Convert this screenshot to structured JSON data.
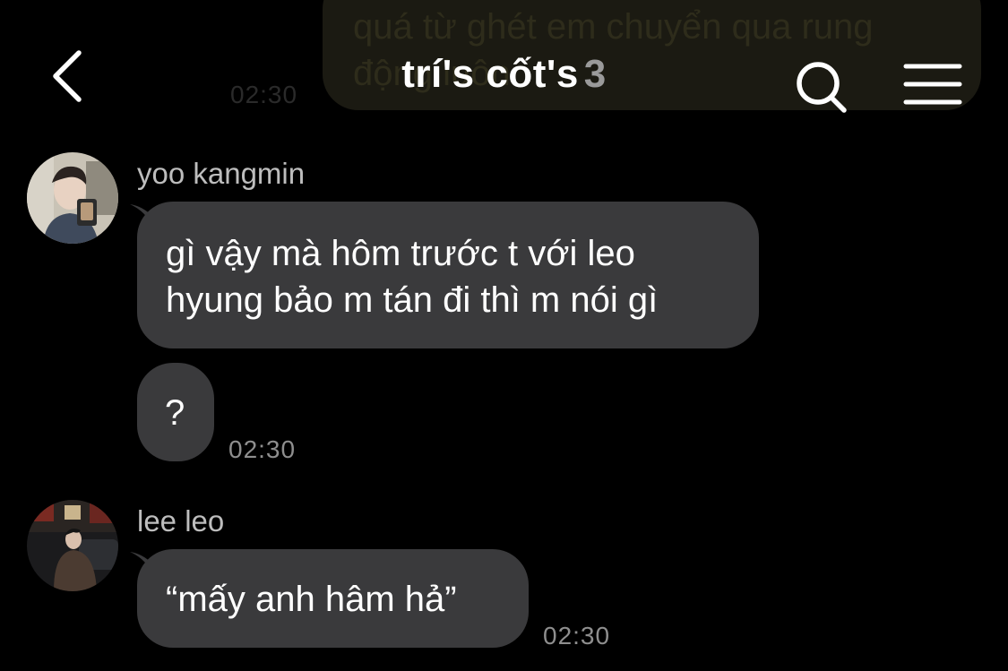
{
  "chat": {
    "title": "trí's cốt's",
    "member_count": "3",
    "back_icon": "chevron-left-icon",
    "search_icon": "search-icon",
    "menu_icon": "hamburger-menu-icon"
  },
  "scrolled_under_header": {
    "text": "quá từ ghét em chuyển qua rung\nđộng luôn",
    "time": "02:30"
  },
  "messages": [
    {
      "sender": "yoo kangmin",
      "bubbles": [
        {
          "text": "gì vậy mà hôm trước t với leo\nhyung bảo m tán đi thì m nói gì"
        },
        {
          "text": "?",
          "time": "02:30"
        }
      ]
    },
    {
      "sender": "lee leo",
      "bubbles": [
        {
          "text": "“mấy anh hâm hả”",
          "time": "02:30"
        }
      ]
    }
  ],
  "colors": {
    "background": "#000000",
    "bubble_incoming": "#3a3a3c",
    "text_primary": "#ffffff",
    "text_secondary": "#8e8e8e"
  }
}
